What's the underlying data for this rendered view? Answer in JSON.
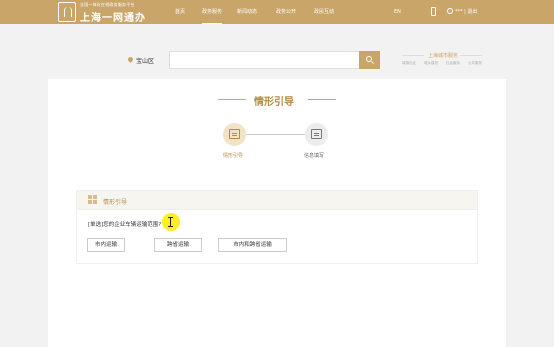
{
  "header": {
    "logo_sub": "全国一体化在线政务服务平台",
    "logo_main": "上海一网通办",
    "nav": [
      {
        "label": "首页"
      },
      {
        "label": "政务服务"
      },
      {
        "label": "新闻动态"
      },
      {
        "label": "政务公开"
      },
      {
        "label": "政民互动"
      }
    ],
    "lang": "EN",
    "login_register": "*** | 退出"
  },
  "search": {
    "location": "宝山区",
    "placeholder": ""
  },
  "brand": {
    "title": "上海城市服务",
    "links": [
      "城镇社区",
      "城乡建设",
      "社会服务",
      "公共服务"
    ]
  },
  "section": {
    "title": "情形引导",
    "steps": [
      {
        "label": "情形引导",
        "active": true
      },
      {
        "label": "信息填写",
        "active": false
      }
    ]
  },
  "guide": {
    "card_title": "情形引导",
    "question": "[单选]您的企业车辆运输范围?",
    "options": [
      "市内运输",
      "跨省运输",
      "市内和跨省运输"
    ]
  },
  "colors": {
    "brand": "#c9a56a",
    "accent_text": "#b48b45",
    "highlight": "#ffeb00"
  }
}
